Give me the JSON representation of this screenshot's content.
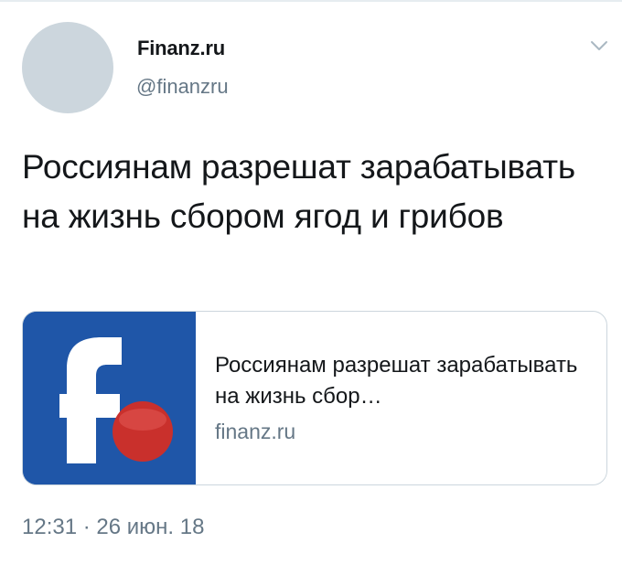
{
  "author": {
    "display_name": "Finanz.ru",
    "handle": "@finanzru"
  },
  "icons": {
    "menu": "chevron-down-icon",
    "avatar": "avatar-placeholder",
    "card_logo": "finanz-logo"
  },
  "tweet": {
    "text": "Россиянам разрешат зарабатывать на жизнь сбором ягод и грибов"
  },
  "card": {
    "title": "Россиянам разрешат зарабатывать на жизнь сбор…",
    "domain": "finanz.ru"
  },
  "meta": {
    "timestamp": "12:31 · 26 июн. 18"
  },
  "colors": {
    "text_primary": "#14171a",
    "text_secondary": "#657786",
    "border": "#ccd6dd",
    "avatar_placeholder": "#ccd6dd",
    "logo_background": "#1f56a8",
    "logo_dot": "#c9302c"
  }
}
